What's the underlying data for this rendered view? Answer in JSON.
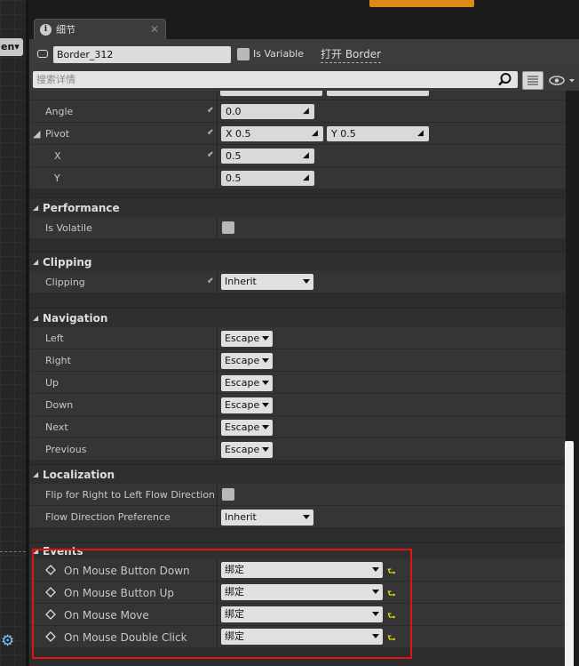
{
  "left_dropdown": "en",
  "tab": {
    "label": "细节"
  },
  "header": {
    "name_value": "Border_312",
    "is_variable_label": "Is Variable",
    "open_link": "打开 Border",
    "search_placeholder": "搜索详情"
  },
  "transform": {
    "angle_label": "Angle",
    "angle_value": "0.0",
    "pivot_label": "Pivot",
    "pivot_x": "X  0.5",
    "pivot_y": "Y  0.5",
    "x_label": "X",
    "x_value": "0.5",
    "y_label": "Y",
    "y_value": "0.5"
  },
  "performance": {
    "title": "Performance",
    "is_volatile_label": "Is Volatile"
  },
  "clipping": {
    "title": "Clipping",
    "clipping_label": "Clipping",
    "clipping_value": "Inherit"
  },
  "navigation": {
    "title": "Navigation",
    "items": [
      {
        "label": "Left",
        "value": "Escape"
      },
      {
        "label": "Right",
        "value": "Escape"
      },
      {
        "label": "Up",
        "value": "Escape"
      },
      {
        "label": "Down",
        "value": "Escape"
      },
      {
        "label": "Next",
        "value": "Escape"
      },
      {
        "label": "Previous",
        "value": "Escape"
      }
    ]
  },
  "localization": {
    "title": "Localization",
    "flip_label": "Flip for Right to Left Flow Direction",
    "flow_label": "Flow Direction Preference",
    "flow_value": "Inherit"
  },
  "events": {
    "title": "Events",
    "items": [
      {
        "label": "On Mouse Button Down",
        "value": "绑定"
      },
      {
        "label": "On Mouse Button Up",
        "value": "绑定"
      },
      {
        "label": "On Mouse Move",
        "value": "绑定"
      },
      {
        "label": "On Mouse Double Click",
        "value": "绑定"
      }
    ]
  },
  "colors": {
    "highlight": "#e31313",
    "accent_orange": "#e08a16",
    "panel_bg": "#3a3a3a"
  }
}
